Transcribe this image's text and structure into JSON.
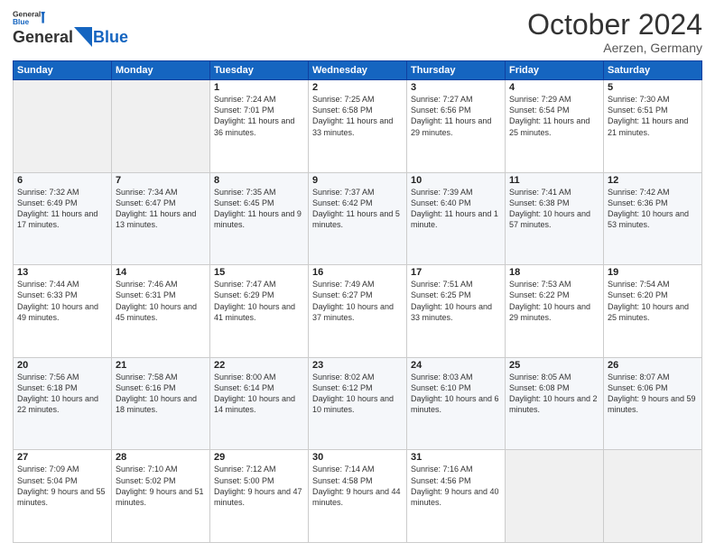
{
  "header": {
    "logo_line1": "General",
    "logo_line2": "Blue",
    "month": "October 2024",
    "location": "Aerzen, Germany"
  },
  "weekdays": [
    "Sunday",
    "Monday",
    "Tuesday",
    "Wednesday",
    "Thursday",
    "Friday",
    "Saturday"
  ],
  "weeks": [
    [
      {
        "day": "",
        "text": ""
      },
      {
        "day": "",
        "text": ""
      },
      {
        "day": "1",
        "text": "Sunrise: 7:24 AM\nSunset: 7:01 PM\nDaylight: 11 hours and 36 minutes."
      },
      {
        "day": "2",
        "text": "Sunrise: 7:25 AM\nSunset: 6:58 PM\nDaylight: 11 hours and 33 minutes."
      },
      {
        "day": "3",
        "text": "Sunrise: 7:27 AM\nSunset: 6:56 PM\nDaylight: 11 hours and 29 minutes."
      },
      {
        "day": "4",
        "text": "Sunrise: 7:29 AM\nSunset: 6:54 PM\nDaylight: 11 hours and 25 minutes."
      },
      {
        "day": "5",
        "text": "Sunrise: 7:30 AM\nSunset: 6:51 PM\nDaylight: 11 hours and 21 minutes."
      }
    ],
    [
      {
        "day": "6",
        "text": "Sunrise: 7:32 AM\nSunset: 6:49 PM\nDaylight: 11 hours and 17 minutes."
      },
      {
        "day": "7",
        "text": "Sunrise: 7:34 AM\nSunset: 6:47 PM\nDaylight: 11 hours and 13 minutes."
      },
      {
        "day": "8",
        "text": "Sunrise: 7:35 AM\nSunset: 6:45 PM\nDaylight: 11 hours and 9 minutes."
      },
      {
        "day": "9",
        "text": "Sunrise: 7:37 AM\nSunset: 6:42 PM\nDaylight: 11 hours and 5 minutes."
      },
      {
        "day": "10",
        "text": "Sunrise: 7:39 AM\nSunset: 6:40 PM\nDaylight: 11 hours and 1 minute."
      },
      {
        "day": "11",
        "text": "Sunrise: 7:41 AM\nSunset: 6:38 PM\nDaylight: 10 hours and 57 minutes."
      },
      {
        "day": "12",
        "text": "Sunrise: 7:42 AM\nSunset: 6:36 PM\nDaylight: 10 hours and 53 minutes."
      }
    ],
    [
      {
        "day": "13",
        "text": "Sunrise: 7:44 AM\nSunset: 6:33 PM\nDaylight: 10 hours and 49 minutes."
      },
      {
        "day": "14",
        "text": "Sunrise: 7:46 AM\nSunset: 6:31 PM\nDaylight: 10 hours and 45 minutes."
      },
      {
        "day": "15",
        "text": "Sunrise: 7:47 AM\nSunset: 6:29 PM\nDaylight: 10 hours and 41 minutes."
      },
      {
        "day": "16",
        "text": "Sunrise: 7:49 AM\nSunset: 6:27 PM\nDaylight: 10 hours and 37 minutes."
      },
      {
        "day": "17",
        "text": "Sunrise: 7:51 AM\nSunset: 6:25 PM\nDaylight: 10 hours and 33 minutes."
      },
      {
        "day": "18",
        "text": "Sunrise: 7:53 AM\nSunset: 6:22 PM\nDaylight: 10 hours and 29 minutes."
      },
      {
        "day": "19",
        "text": "Sunrise: 7:54 AM\nSunset: 6:20 PM\nDaylight: 10 hours and 25 minutes."
      }
    ],
    [
      {
        "day": "20",
        "text": "Sunrise: 7:56 AM\nSunset: 6:18 PM\nDaylight: 10 hours and 22 minutes."
      },
      {
        "day": "21",
        "text": "Sunrise: 7:58 AM\nSunset: 6:16 PM\nDaylight: 10 hours and 18 minutes."
      },
      {
        "day": "22",
        "text": "Sunrise: 8:00 AM\nSunset: 6:14 PM\nDaylight: 10 hours and 14 minutes."
      },
      {
        "day": "23",
        "text": "Sunrise: 8:02 AM\nSunset: 6:12 PM\nDaylight: 10 hours and 10 minutes."
      },
      {
        "day": "24",
        "text": "Sunrise: 8:03 AM\nSunset: 6:10 PM\nDaylight: 10 hours and 6 minutes."
      },
      {
        "day": "25",
        "text": "Sunrise: 8:05 AM\nSunset: 6:08 PM\nDaylight: 10 hours and 2 minutes."
      },
      {
        "day": "26",
        "text": "Sunrise: 8:07 AM\nSunset: 6:06 PM\nDaylight: 9 hours and 59 minutes."
      }
    ],
    [
      {
        "day": "27",
        "text": "Sunrise: 7:09 AM\nSunset: 5:04 PM\nDaylight: 9 hours and 55 minutes."
      },
      {
        "day": "28",
        "text": "Sunrise: 7:10 AM\nSunset: 5:02 PM\nDaylight: 9 hours and 51 minutes."
      },
      {
        "day": "29",
        "text": "Sunrise: 7:12 AM\nSunset: 5:00 PM\nDaylight: 9 hours and 47 minutes."
      },
      {
        "day": "30",
        "text": "Sunrise: 7:14 AM\nSunset: 4:58 PM\nDaylight: 9 hours and 44 minutes."
      },
      {
        "day": "31",
        "text": "Sunrise: 7:16 AM\nSunset: 4:56 PM\nDaylight: 9 hours and 40 minutes."
      },
      {
        "day": "",
        "text": ""
      },
      {
        "day": "",
        "text": ""
      }
    ]
  ]
}
